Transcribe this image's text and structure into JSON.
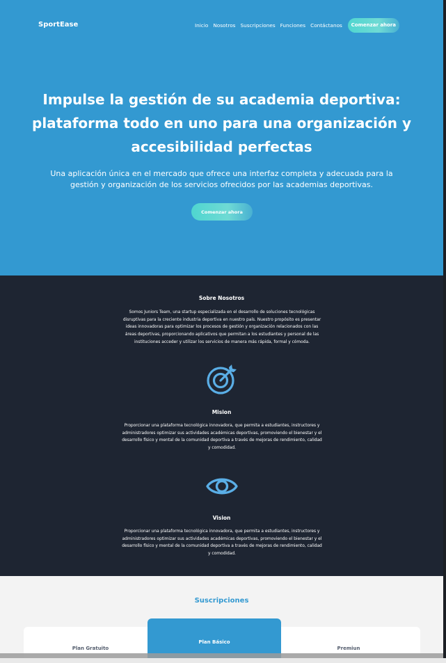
{
  "header": {
    "brand": "SportEase",
    "nav": [
      "Inicio",
      "Nosotros",
      "Suscripciones",
      "Funciones",
      "Contáctanos"
    ],
    "cta": "Comenzar ahora"
  },
  "hero": {
    "title_line1": "Impulse la gestión de su academia deportiva:",
    "title_line2": "plataforma todo en uno para una organización y",
    "title_line3": "accesibilidad perfectas",
    "subtitle_line1": "Una aplicación única en el mercado que ofrece una interfaz completa y adecuada para la",
    "subtitle_line2": "gestión y organización de los servicios ofrecidos por las academias deportivas.",
    "cta": "Comenzar ahora"
  },
  "about": {
    "title": "Sobre Nosotros",
    "lines": [
      "Somos Juniors Team, una startup especializada en el desarrollo de soluciones tecnológicas",
      "disruptivas para la creciente industria deportiva en nuestro país. Nuestro propósito es presentar",
      "ideas innovadoras para optimizar los procesos de gestión y organización relacionados con las",
      "áreas deportivas, proporcionando aplicativos que permitan a los estudiantes y personal de las",
      "instituciones acceder y utilizar los servicios de manera más rápida, formal y cómoda."
    ]
  },
  "mission": {
    "icon": "target-icon",
    "title": "Mision",
    "lines": [
      "Proporcionar una plataforma tecnológica innovadora, que permita a estudiantes, instructores y",
      "administradores optimizar sus actividades académicas deportivas, promoviendo el bienestar y el",
      "desarrollo físico y mental de la comunidad deportiva a través de mejoras de rendimiento, calidad",
      "y comodidad."
    ]
  },
  "vision": {
    "icon": "eye-icon",
    "title": "Vision",
    "lines": [
      "Proporcionar una plataforma tecnológica innovadora, que permita a estudiantes, instructores y",
      "administradores optimizar sus actividades académicas deportivas, promoviendo el bienestar y el",
      "desarrollo físico y mental de la comunidad deportiva a través de mejoras de rendimiento, calidad",
      "y comodidad."
    ]
  },
  "subscriptions": {
    "title": "Suscripciones",
    "plans": [
      "Plan Gratuito",
      "Plan Básico",
      "Premiun"
    ]
  },
  "colors": {
    "hero_bg": "#3399d1",
    "dark_bg": "#1e2532",
    "accent": "#4fd6d0",
    "icon": "#5aaee6"
  }
}
